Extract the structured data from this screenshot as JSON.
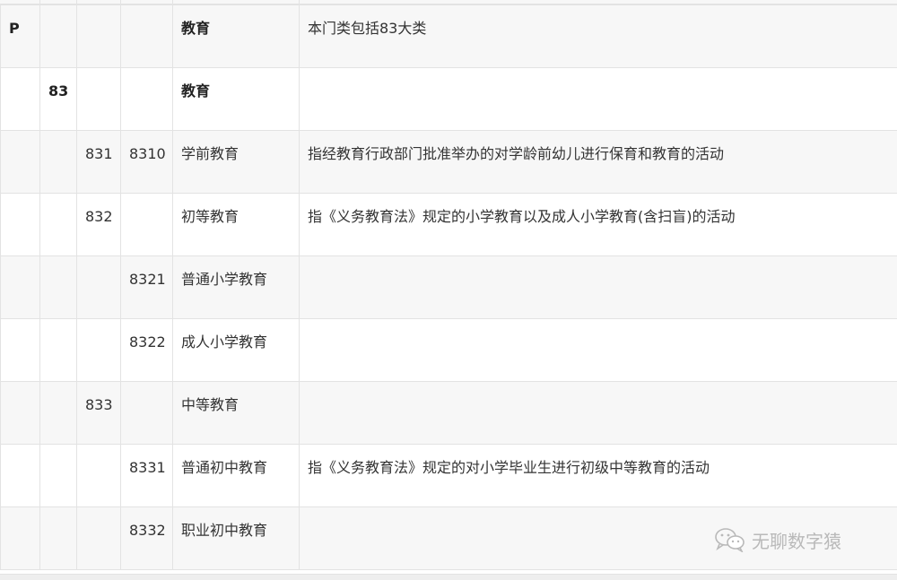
{
  "table": {
    "rows": [
      {
        "cells": [
          "P",
          "",
          "",
          "",
          "教育",
          "本门类包括83大类"
        ],
        "bold": [
          true,
          false,
          false,
          false,
          true,
          false
        ]
      },
      {
        "cells": [
          "",
          "83",
          "",
          "",
          "教育",
          ""
        ],
        "bold": [
          false,
          true,
          false,
          false,
          true,
          false
        ]
      },
      {
        "cells": [
          "",
          "",
          "831",
          "8310",
          "学前教育",
          "指经教育行政部门批准举办的对学龄前幼儿进行保育和教育的活动"
        ],
        "bold": [
          false,
          false,
          false,
          false,
          false,
          false
        ]
      },
      {
        "cells": [
          "",
          "",
          "832",
          "",
          "初等教育",
          "指《义务教育法》规定的小学教育以及成人小学教育(含扫盲)的活动"
        ],
        "bold": [
          false,
          false,
          false,
          false,
          false,
          false
        ]
      },
      {
        "cells": [
          "",
          "",
          "",
          "8321",
          "普通小学教育",
          ""
        ],
        "bold": [
          false,
          false,
          false,
          false,
          false,
          false
        ]
      },
      {
        "cells": [
          "",
          "",
          "",
          "8322",
          "成人小学教育",
          ""
        ],
        "bold": [
          false,
          false,
          false,
          false,
          false,
          false
        ]
      },
      {
        "cells": [
          "",
          "",
          "833",
          "",
          "中等教育",
          ""
        ],
        "bold": [
          false,
          false,
          false,
          false,
          false,
          false
        ]
      },
      {
        "cells": [
          "",
          "",
          "",
          "8331",
          "普通初中教育",
          "指《义务教育法》规定的对小学毕业生进行初级中等教育的活动"
        ],
        "bold": [
          false,
          false,
          false,
          false,
          false,
          false
        ]
      },
      {
        "cells": [
          "",
          "",
          "",
          "8332",
          "职业初中教育",
          ""
        ],
        "bold": [
          false,
          false,
          false,
          false,
          false,
          false
        ]
      }
    ]
  },
  "watermark": {
    "text": "无聊数字猿",
    "icon": "wechat-icon",
    "color": "#b9b9b9"
  }
}
